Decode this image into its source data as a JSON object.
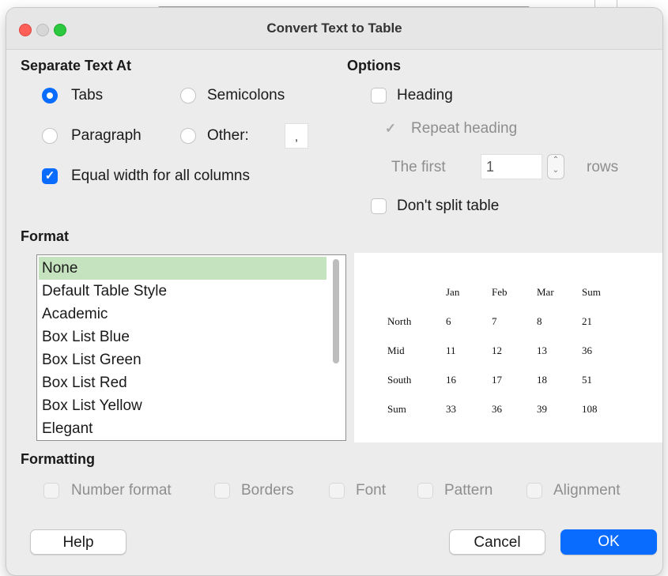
{
  "window": {
    "title": "Convert Text to Table"
  },
  "separate": {
    "heading": "Separate Text At",
    "tabs": "Tabs",
    "semicolons": "Semicolons",
    "paragraph": "Paragraph",
    "other": "Other:",
    "other_value": ",",
    "equal_width": "Equal width for all columns",
    "selected": "Tabs",
    "equal_width_checked": true
  },
  "options": {
    "heading": "Options",
    "heading_label": "Heading",
    "heading_checked": false,
    "repeat_heading": "Repeat heading",
    "repeat_heading_checked": true,
    "first_label": "The first",
    "first_value": "1",
    "rows_label": "rows",
    "dont_split": "Don't split table",
    "dont_split_checked": false
  },
  "format": {
    "heading": "Format",
    "items": [
      "None",
      "Default Table Style",
      "Academic",
      "Box List Blue",
      "Box List Green",
      "Box List Red",
      "Box List Yellow",
      "Elegant"
    ],
    "selected": "None",
    "selected_color": "#c6e3bf"
  },
  "preview": {
    "header": [
      "",
      "Jan",
      "Feb",
      "Mar",
      "Sum"
    ],
    "rows": [
      [
        "North",
        "6",
        "7",
        "8",
        "21"
      ],
      [
        "Mid",
        "11",
        "12",
        "13",
        "36"
      ],
      [
        "South",
        "16",
        "17",
        "18",
        "51"
      ],
      [
        "Sum",
        "33",
        "36",
        "39",
        "108"
      ]
    ]
  },
  "formatting": {
    "heading": "Formatting",
    "number_format": "Number format",
    "borders": "Borders",
    "font": "Font",
    "pattern": "Pattern",
    "alignment": "Alignment"
  },
  "buttons": {
    "help": "Help",
    "cancel": "Cancel",
    "ok": "OK"
  },
  "colors": {
    "accent": "#0a6cff",
    "dialog_bg": "#ececec"
  },
  "icons": {
    "radio_on": "radio-selected-icon",
    "checkbox_on": "checkmark-icon",
    "spin": "spin-arrows-icon"
  }
}
